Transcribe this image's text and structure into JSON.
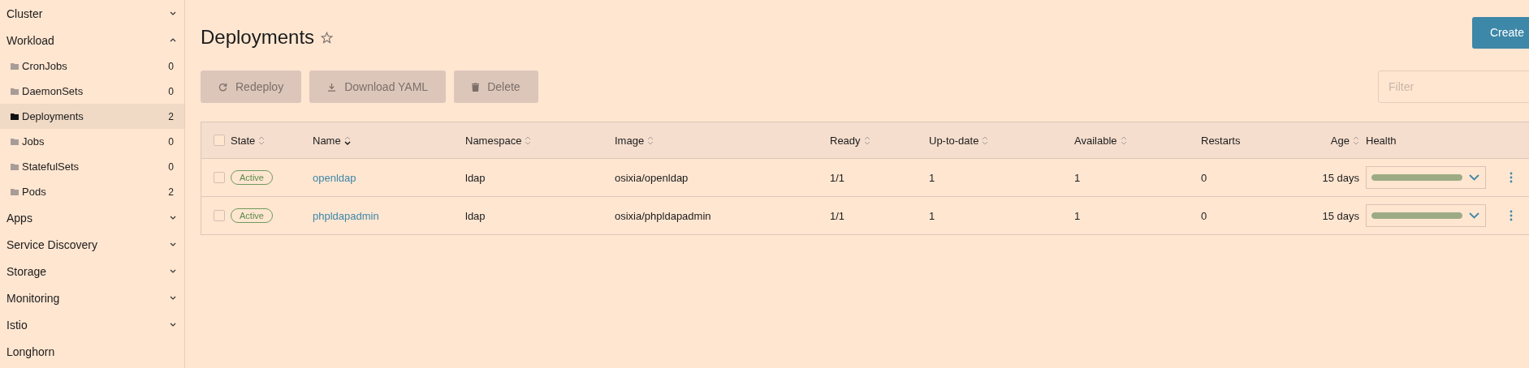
{
  "sidebar": {
    "items": [
      {
        "kind": "group",
        "label": "Cluster",
        "expanded": false
      },
      {
        "kind": "group",
        "label": "Workload",
        "expanded": true,
        "children": [
          {
            "label": "CronJobs",
            "count": "0",
            "selected": false
          },
          {
            "label": "DaemonSets",
            "count": "0",
            "selected": false
          },
          {
            "label": "Deployments",
            "count": "2",
            "selected": true
          },
          {
            "label": "Jobs",
            "count": "0",
            "selected": false
          },
          {
            "label": "StatefulSets",
            "count": "0",
            "selected": false
          },
          {
            "label": "Pods",
            "count": "2",
            "selected": false
          }
        ]
      },
      {
        "kind": "group",
        "label": "Apps",
        "expanded": false
      },
      {
        "kind": "group",
        "label": "Service Discovery",
        "expanded": false
      },
      {
        "kind": "group",
        "label": "Storage",
        "expanded": false
      },
      {
        "kind": "group",
        "label": "Monitoring",
        "expanded": false
      },
      {
        "kind": "group",
        "label": "Istio",
        "expanded": false
      },
      {
        "kind": "link",
        "label": "Longhorn"
      }
    ]
  },
  "page": {
    "title": "Deployments",
    "create_button": "Create"
  },
  "actions": [
    {
      "kind": "redeploy",
      "label": "Redeploy"
    },
    {
      "kind": "download",
      "label": "Download YAML"
    },
    {
      "kind": "delete",
      "label": "Delete"
    }
  ],
  "filter": {
    "placeholder": "Filter"
  },
  "table": {
    "select_all_checked": false,
    "columns": [
      {
        "label": "State",
        "sortable": true,
        "sorted": false
      },
      {
        "label": "Name",
        "sortable": true,
        "sorted": true
      },
      {
        "label": "Namespace",
        "sortable": true,
        "sorted": false
      },
      {
        "label": "Image",
        "sortable": true,
        "sorted": false
      },
      {
        "label": "Ready",
        "sortable": true,
        "sorted": false
      },
      {
        "label": "Up-to-date",
        "sortable": true,
        "sorted": false
      },
      {
        "label": "Available",
        "sortable": true,
        "sorted": false
      },
      {
        "label": "Restarts",
        "sortable": false
      },
      {
        "label": "Age",
        "sortable": true,
        "sorted": false
      },
      {
        "label": "Health",
        "sortable": false
      }
    ],
    "rows": [
      {
        "checked": false,
        "state": "Active",
        "name": "openldap",
        "namespace": "ldap",
        "image": "osixia/openldap",
        "ready": "1/1",
        "up_to_date": "1",
        "available": "1",
        "restarts": "0",
        "age": "15 days",
        "health": {
          "level": 1
        }
      },
      {
        "checked": false,
        "state": "Active",
        "name": "phpldapadmin",
        "namespace": "ldap",
        "image": "osixia/phpldapadmin",
        "ready": "1/1",
        "up_to_date": "1",
        "available": "1",
        "restarts": "0",
        "age": "15 days",
        "health": {
          "level": 1
        }
      }
    ]
  }
}
